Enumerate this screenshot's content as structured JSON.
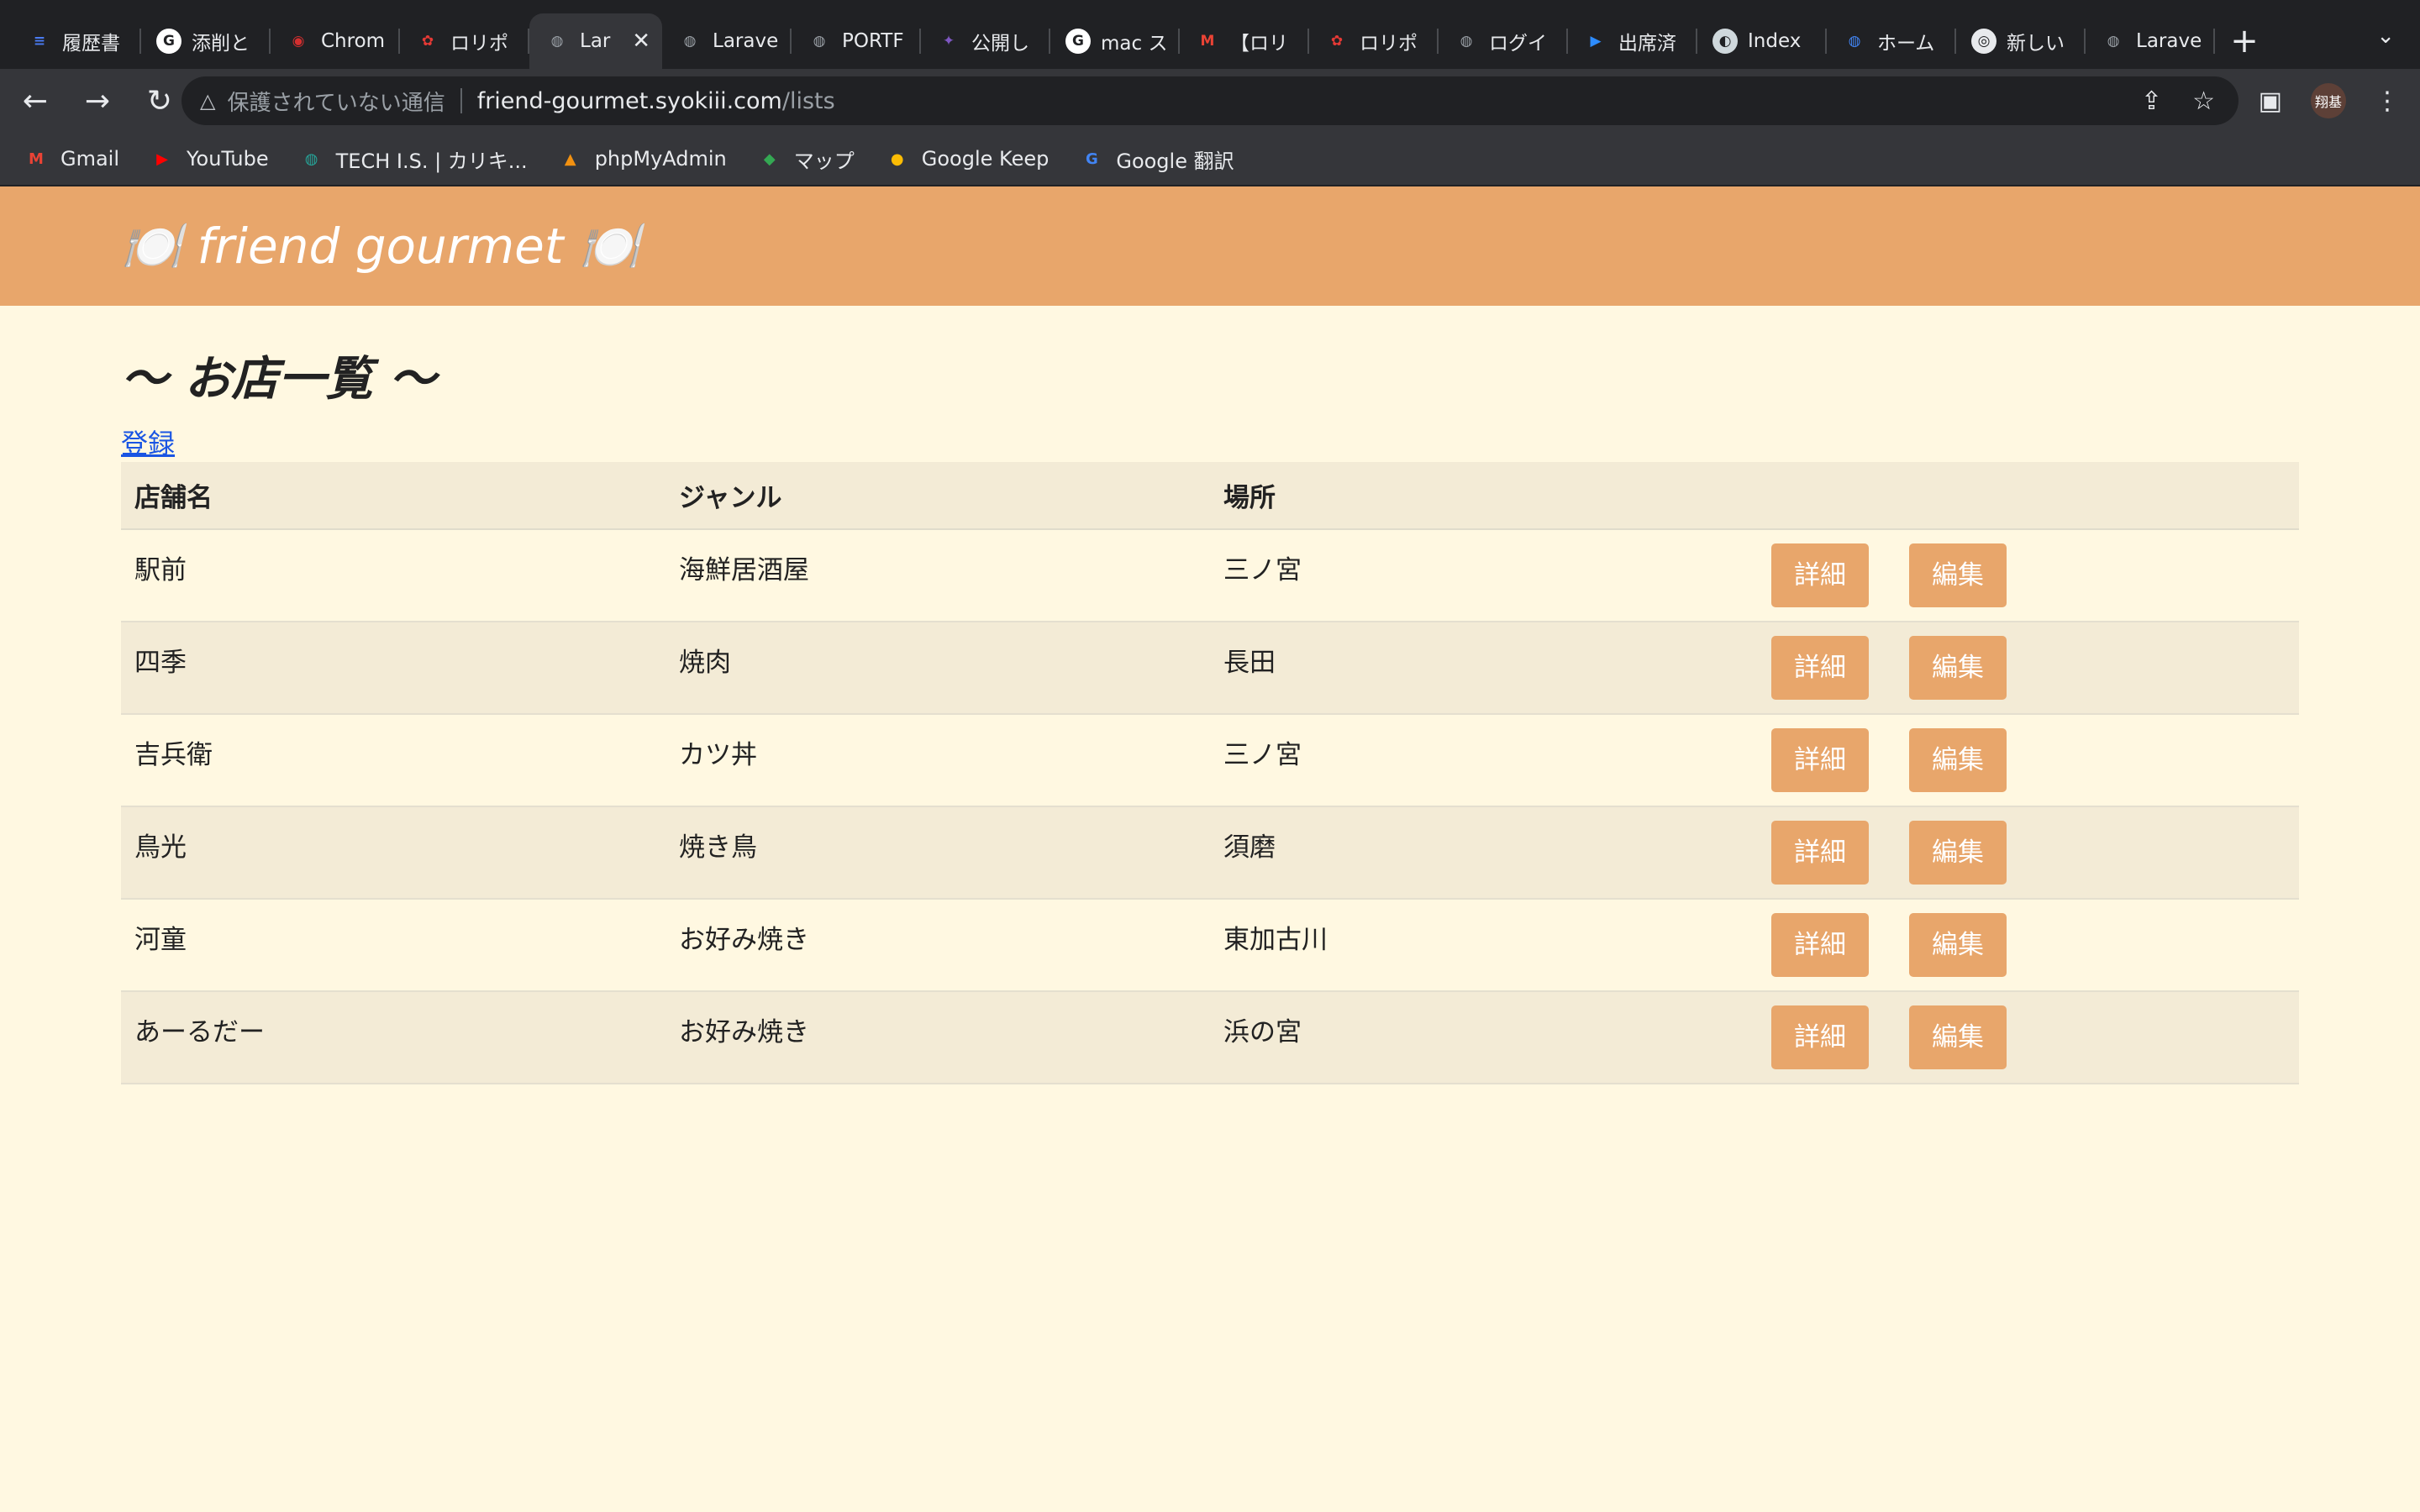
{
  "browser": {
    "tabs": [
      {
        "title": "履歴書",
        "icon": "docs-icon",
        "color": "#4a7cf5",
        "glyph": "≡"
      },
      {
        "title": "添削と",
        "icon": "google-icon",
        "color": "#ffffff",
        "glyph": "G"
      },
      {
        "title": "Chrom",
        "icon": "chrome-red-icon",
        "color": "#d32f2f",
        "glyph": "◉"
      },
      {
        "title": "ロリポ",
        "icon": "lolipop-icon",
        "color": "#e53935",
        "glyph": "✿"
      },
      {
        "title": "Lar",
        "icon": "globe-icon",
        "color": "#9aa0a6",
        "glyph": "◍",
        "active": true
      },
      {
        "title": "Larave",
        "icon": "globe-icon",
        "color": "#9aa0a6",
        "glyph": "◍"
      },
      {
        "title": "PORTF",
        "icon": "globe-icon",
        "color": "#9aa0a6",
        "glyph": "◍"
      },
      {
        "title": "公開し",
        "icon": "mascot-icon",
        "color": "#7e57c2",
        "glyph": "✦"
      },
      {
        "title": "mac ス",
        "icon": "google-icon",
        "color": "#ffffff",
        "glyph": "G"
      },
      {
        "title": "【ロリ",
        "icon": "gmail-icon",
        "color": "#ea4335",
        "glyph": "M"
      },
      {
        "title": "ロリポ",
        "icon": "lolipop-icon",
        "color": "#e53935",
        "glyph": "✿"
      },
      {
        "title": "ログイ",
        "icon": "globe-icon",
        "color": "#9aa0a6",
        "glyph": "◍"
      },
      {
        "title": "出席済",
        "icon": "zoom-icon",
        "color": "#2d8cff",
        "glyph": "▶"
      },
      {
        "title": "Index",
        "icon": "elephant-icon",
        "color": "#cfd8dc",
        "glyph": "◐"
      },
      {
        "title": "ホーム",
        "icon": "globe-blue-icon",
        "color": "#4285f4",
        "glyph": "◍"
      },
      {
        "title": "新しい",
        "icon": "chrome-icon",
        "color": "#e8eaed",
        "glyph": "◎"
      },
      {
        "title": "Larave",
        "icon": "globe-icon",
        "color": "#9aa0a6",
        "glyph": "◍"
      }
    ],
    "new_tab_glyph": "+",
    "tab_search_glyph": "⌄",
    "close_glyph": "✕",
    "nav": {
      "back": "←",
      "forward": "→",
      "reload": "↻"
    },
    "security_icon": "△",
    "security_text": "保護されていない通信",
    "url_host": "friend-gourmet.syokiii.com",
    "url_path": "/lists",
    "share_glyph": "⇪",
    "star_glyph": "☆",
    "sidepanel_glyph": "▣",
    "profile_text": "翔基",
    "menu_glyph": "⋮",
    "bookmarks": [
      {
        "label": "Gmail",
        "icon": "gmail-icon",
        "color": "#ea4335",
        "glyph": "M"
      },
      {
        "label": "YouTube",
        "icon": "youtube-icon",
        "color": "#ff0000",
        "glyph": "▶"
      },
      {
        "label": "TECH I.S. | カリキ...",
        "icon": "globe-icon",
        "color": "#26a69a",
        "glyph": "◍"
      },
      {
        "label": "phpMyAdmin",
        "icon": "phpmyadmin-icon",
        "color": "#f29111",
        "glyph": "▲"
      },
      {
        "label": "マップ",
        "icon": "maps-icon",
        "color": "#34a853",
        "glyph": "◆"
      },
      {
        "label": "Google Keep",
        "icon": "keep-icon",
        "color": "#fbbc04",
        "glyph": "●"
      },
      {
        "label": "Google 翻訳",
        "icon": "translate-icon",
        "color": "#4285f4",
        "glyph": "G"
      }
    ]
  },
  "page": {
    "brand": "🍽️ friend gourmet 🍽️",
    "title": "〜 お店一覧 〜",
    "register_link": "登録",
    "table": {
      "headers": [
        "店舗名",
        "ジャンル",
        "場所",
        ""
      ],
      "detail_label": "詳細",
      "edit_label": "編集",
      "rows": [
        {
          "name": "駅前",
          "genre": "海鮮居酒屋",
          "place": "三ノ宮"
        },
        {
          "name": "四季",
          "genre": "焼肉",
          "place": "長田"
        },
        {
          "name": "吉兵衛",
          "genre": "カツ丼",
          "place": "三ノ宮"
        },
        {
          "name": "鳥光",
          "genre": "焼き鳥",
          "place": "須磨"
        },
        {
          "name": "河童",
          "genre": "お好み焼き",
          "place": "東加古川"
        },
        {
          "name": "あーるだー",
          "genre": "お好み焼き",
          "place": "浜の宮"
        }
      ]
    }
  }
}
